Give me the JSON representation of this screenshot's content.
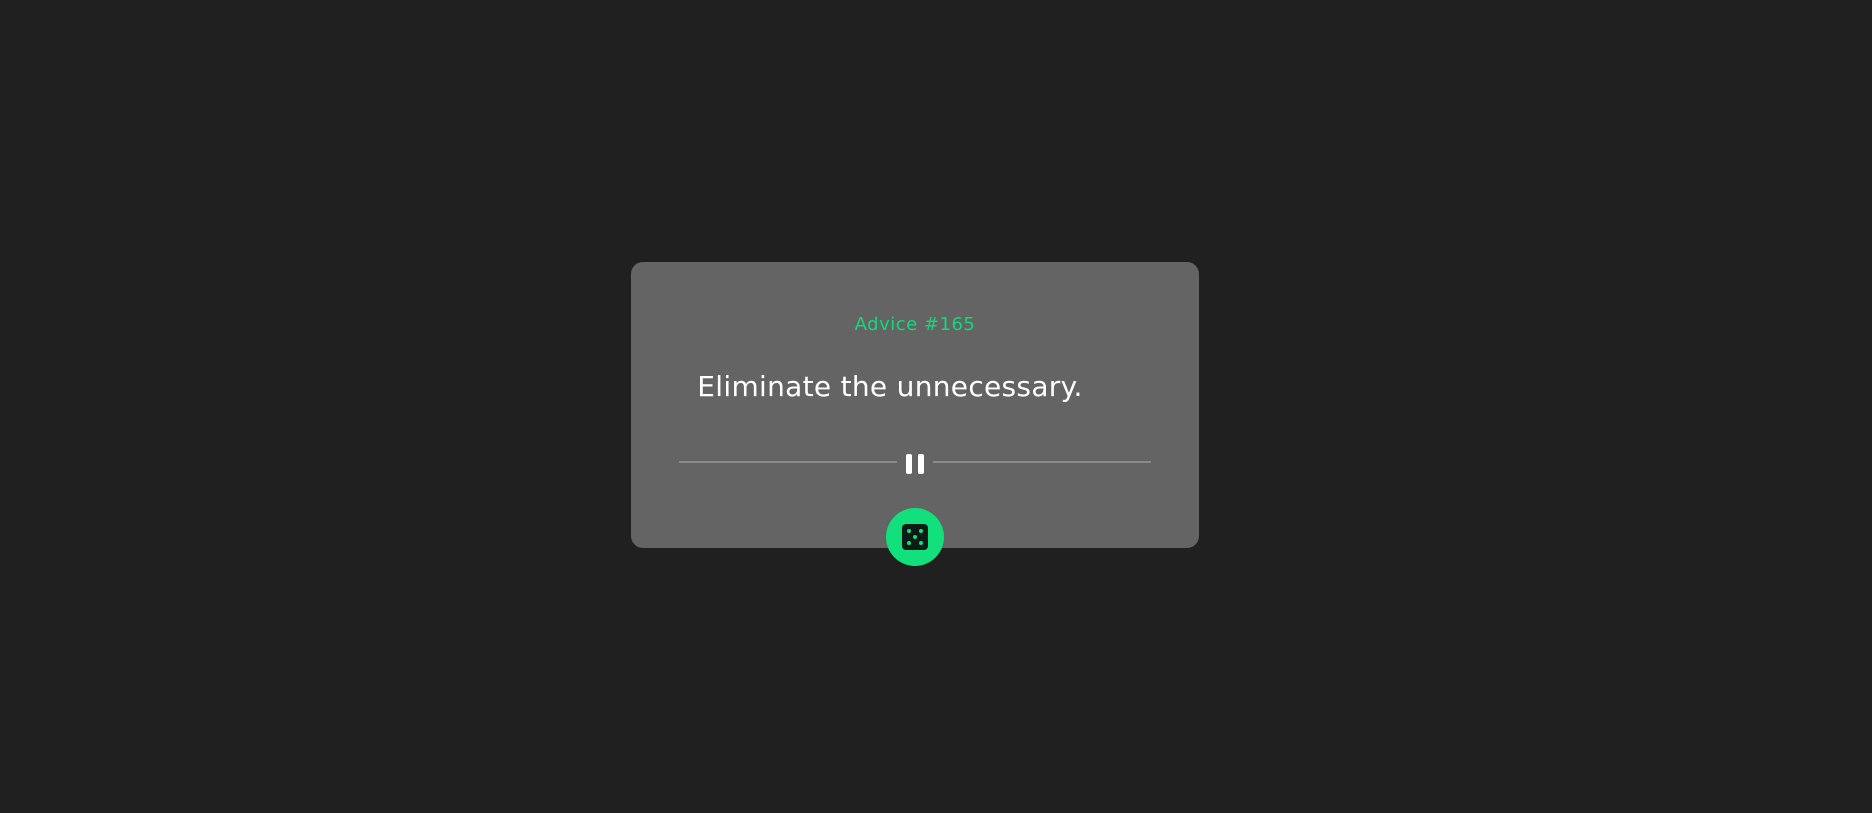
{
  "card": {
    "advice_label": "Advice #165",
    "advice_text": "Eliminate the unnecessary."
  },
  "icons": {
    "divider": "pause-icon",
    "button": "dice-icon"
  },
  "colors": {
    "page_background": "#202020",
    "card_background": "#646464",
    "accent": "#12e07c",
    "text": "#ffffff"
  }
}
